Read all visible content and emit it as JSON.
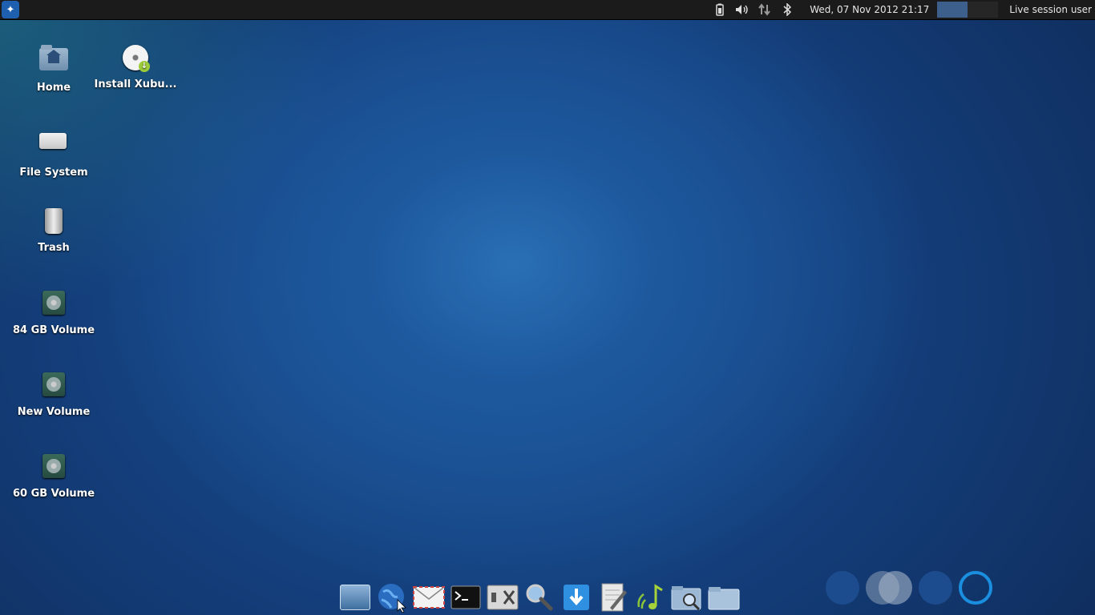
{
  "top_panel": {
    "clock": "Wed, 07 Nov 2012 21:17",
    "user": "Live session user",
    "tray_icons": [
      "battery-icon",
      "volume-icon",
      "network-icon",
      "bluetooth-icon"
    ]
  },
  "desktop": {
    "icons": [
      {
        "label": "Home",
        "icon": "home-folder-icon"
      },
      {
        "label": "Install Xubu...",
        "icon": "install-disc-icon"
      },
      {
        "label": "File System",
        "icon": "hard-drive-icon"
      },
      {
        "label": "Trash",
        "icon": "trash-icon"
      },
      {
        "label": "84 GB Volume",
        "icon": "volume-icon"
      },
      {
        "label": "New Volume",
        "icon": "volume-icon"
      },
      {
        "label": "60 GB Volume",
        "icon": "volume-icon"
      }
    ]
  },
  "dock": {
    "items": [
      "show-desktop-icon",
      "web-browser-icon",
      "mail-icon",
      "terminal-icon",
      "settings-icon",
      "search-icon",
      "download-icon",
      "text-editor-icon",
      "media-player-icon",
      "file-search-icon",
      "folder-icon"
    ]
  },
  "colors": {
    "panel": "#1b1b1b",
    "wallpaper": "#1b5497",
    "accent": "#1e5fb0"
  }
}
